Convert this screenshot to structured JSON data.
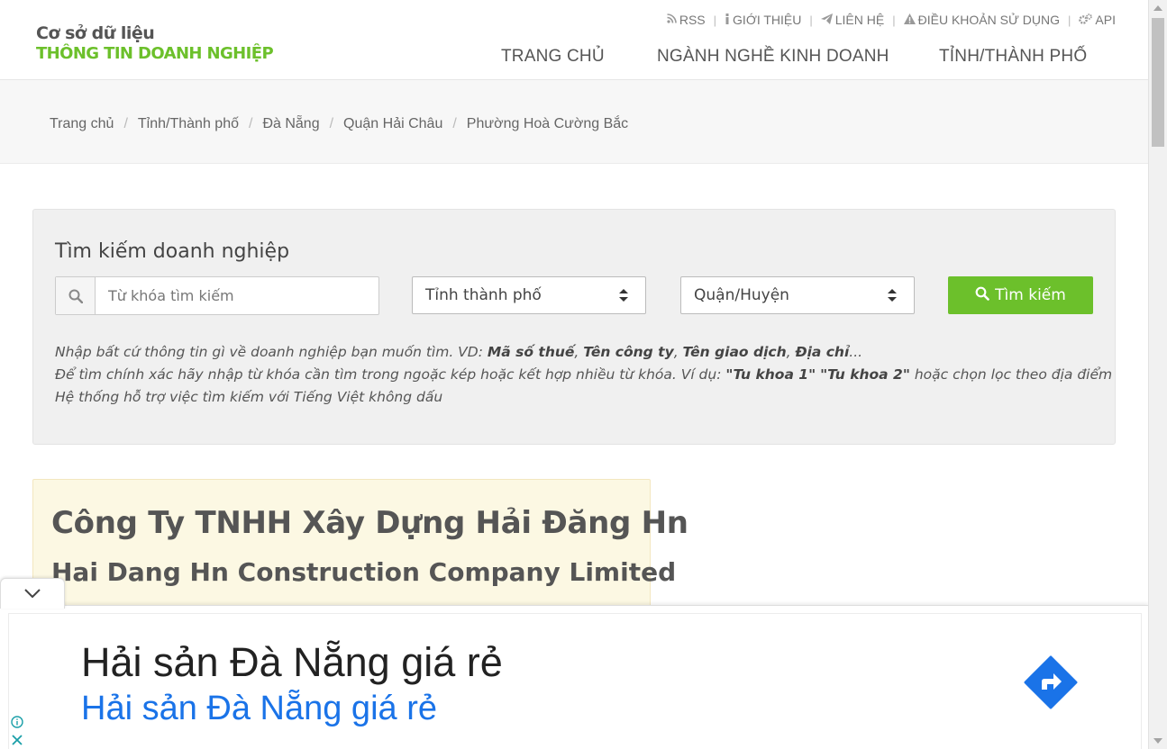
{
  "logo": {
    "line1": "Cơ sở dữ liệu",
    "line2": "THÔNG TIN DOANH NGHIỆP"
  },
  "top_links": [
    {
      "icon": "rss-icon",
      "label": "RSS"
    },
    {
      "icon": "info-icon",
      "label": "GIỚI THIỆU"
    },
    {
      "icon": "send-icon",
      "label": "LIÊN HỆ"
    },
    {
      "icon": "warning-icon",
      "label": "ĐIỀU KHOẢN SỬ DỤNG"
    },
    {
      "icon": "gears-icon",
      "label": "API"
    }
  ],
  "main_nav": [
    "TRANG CHỦ",
    "NGÀNH NGHỀ KINH DOANH",
    "TỈNH/THÀNH PHỐ"
  ],
  "breadcrumb": [
    "Trang chủ",
    "Tỉnh/Thành phố",
    "Đà Nẵng",
    "Quận Hải Châu",
    "Phường Hoà Cường Bắc"
  ],
  "search": {
    "title": "Tìm kiếm doanh nghiệp",
    "keyword_placeholder": "Từ khóa tìm kiếm",
    "province_selected": "Tỉnh thành phố",
    "district_selected": "Quận/Huyện",
    "button_label": "Tìm kiếm",
    "hint1_prefix": "Nhập bất cứ thông tin gì về doanh nghiệp bạn muốn tìm. VD: ",
    "hint1_b1": "Mã số thuế",
    "hint1_b2": "Tên công ty",
    "hint1_b3": "Tên giao dịch",
    "hint1_b4": "Địa chỉ",
    "hint1_suffix": "...",
    "hint2_prefix": "Để tìm chính xác hãy nhập từ khóa cần tìm trong ngoặc kép hoặc kết hợp nhiều từ khóa. Ví dụ: ",
    "hint2_b1": "\"Tu khoa 1\"",
    "hint2_b2": "\"Tu khoa 2\"",
    "hint2_suffix": " hoặc chọn lọc theo địa điểm",
    "hint3": "Hệ thống hỗ trợ việc tìm kiếm với Tiếng Việt không dấu"
  },
  "company": {
    "name": "Công Ty TNHH Xây Dựng Hải Đăng Hn",
    "name_en": "Hai Dang Hn Construction Company Limited"
  },
  "ad": {
    "headline": "Hải sản Đà Nẵng giá rẻ",
    "subline": "Hải sản Đà Nẵng giá rẻ"
  },
  "colors": {
    "brand_green": "#6cc02b",
    "ad_blue": "#1a73e8",
    "card_bg": "#fcf8e3"
  }
}
